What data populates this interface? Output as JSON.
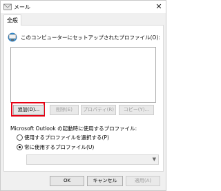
{
  "window": {
    "title": "メール",
    "close_icon": "close-icon"
  },
  "tabs": [
    {
      "label": "全般"
    }
  ],
  "general": {
    "profile_label": "このコンピューターにセットアップされたプロファイル(O):",
    "buttons": {
      "add": "追加(D)...",
      "remove": "削除(E)",
      "properties": "プロパティ(R)",
      "copy": "コピー(Y)..."
    },
    "startup_label": "Microsoft Outlook の起動時に使用するプロファイル:",
    "radio_prompt": "使用するプロファイルを選択する(P)",
    "radio_always": "常に使用するプロファイル(U)",
    "selected_radio": "always",
    "profile_select_value": ""
  },
  "footer": {
    "ok": "OK",
    "cancel": "キャンセル",
    "apply": "適用(A)"
  },
  "colors": {
    "highlight": "#e60012",
    "window_bg": "#f0f0f0"
  }
}
